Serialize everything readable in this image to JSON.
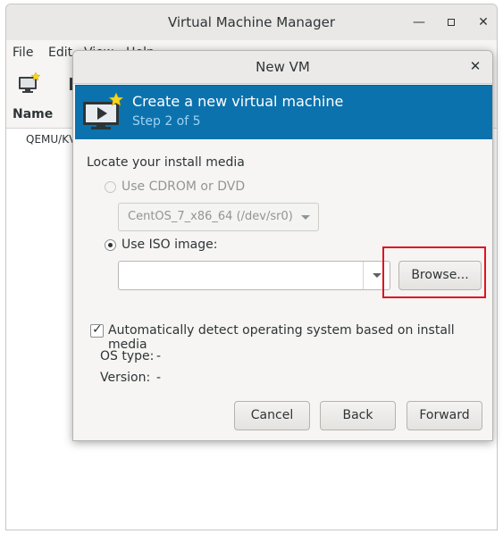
{
  "main_window": {
    "title": "Virtual Machine Manager",
    "menu": [
      "File",
      "Edit",
      "View",
      "Help"
    ],
    "list_header": "Name",
    "connection": "QEMU/KVM"
  },
  "dialog": {
    "title": "New VM",
    "banner_title": "Create a new virtual machine",
    "banner_subtitle": "Step 2 of 5",
    "section_label": "Locate your install media",
    "cdrom_option": "Use CDROM or DVD",
    "cdrom_selected_device": "CentOS_7_x86_64 (/dev/sr0)",
    "iso_option": "Use ISO image:",
    "iso_path": "",
    "browse_label": "Browse...",
    "auto_detect_label": "Automatically detect operating system based on install media",
    "auto_detect_checked": true,
    "os_type_label": "OS type:",
    "os_type_value": "-",
    "version_label": "Version:",
    "version_value": "-",
    "cancel_label": "Cancel",
    "back_label": "Back",
    "forward_label": "Forward"
  },
  "colors": {
    "banner_bg": "#0c72ad",
    "highlight": "#e0131f"
  },
  "icons": {
    "new_vm": "monitor-star-icon"
  }
}
